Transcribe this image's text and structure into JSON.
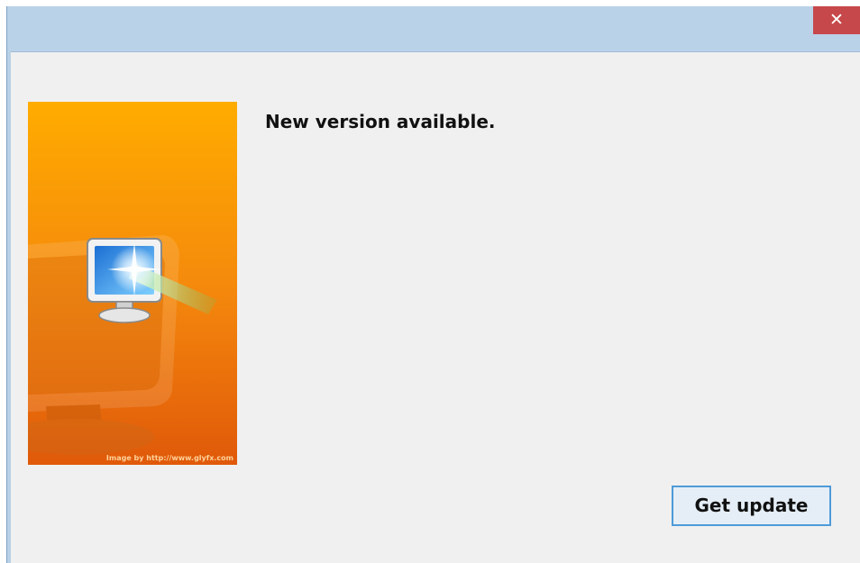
{
  "window": {
    "close_glyph": "✕"
  },
  "dialog": {
    "heading": "New version available.",
    "banner_credit": "Image by http://www.glyfx.com",
    "get_update_label": "Get update"
  },
  "colors": {
    "titlebar": "#bad2e8",
    "close_button": "#c7484a",
    "client_background": "#f0f0f0",
    "button_border": "#4e9ad8",
    "banner_top": "#ffac00",
    "banner_bottom": "#e25e08"
  },
  "icons": {
    "banner": "monitor-update-icon",
    "close": "close-icon"
  }
}
